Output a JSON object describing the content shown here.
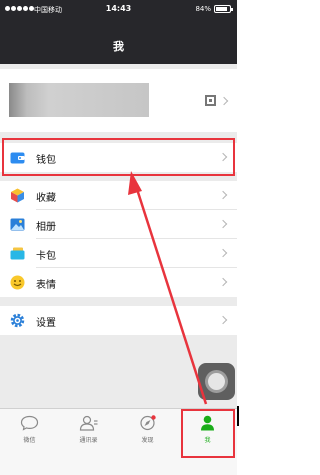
{
  "status_bar": {
    "carrier": "中国移动",
    "time": "14:43",
    "battery": "84%",
    "battery_level": 0.84
  },
  "header": {
    "title": "我"
  },
  "menu": {
    "wallet": "钱包",
    "favorites": "收藏",
    "album": "相册",
    "cards": "卡包",
    "stickers": "表情",
    "settings": "设置"
  },
  "tabs": [
    {
      "label": "微信"
    },
    {
      "label": "通讯录"
    },
    {
      "label": "发现"
    },
    {
      "label": "我"
    }
  ],
  "colors": {
    "highlight": "#e8343d",
    "brand_green": "#1aad19",
    "header_bg": "#27272b"
  }
}
